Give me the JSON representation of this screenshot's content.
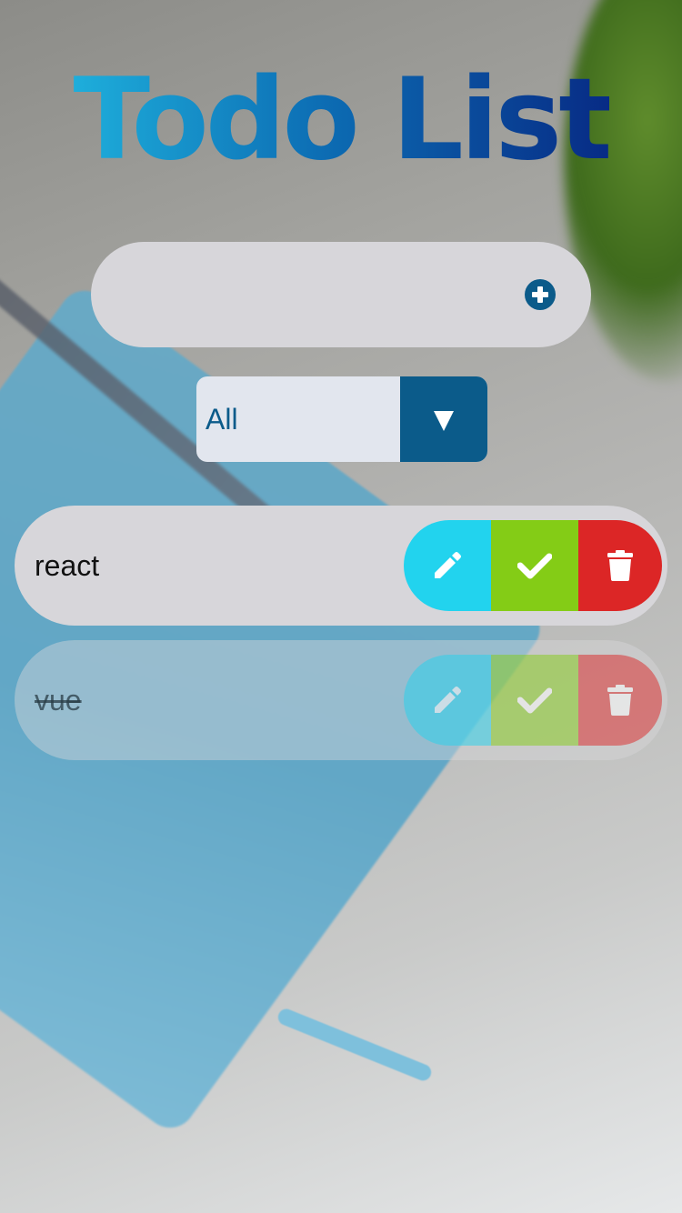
{
  "app": {
    "title": "Todo List"
  },
  "new_todo": {
    "value": "",
    "placeholder": "",
    "add_icon": "plus-circle-icon"
  },
  "filter": {
    "selected": "All",
    "toggle_icon": "triangle-down-icon"
  },
  "todos": [
    {
      "text": "react",
      "completed": false
    },
    {
      "text": "vue",
      "completed": true
    }
  ],
  "actions": {
    "edit_icon": "pencil-icon",
    "complete_icon": "check-icon",
    "delete_icon": "trash-icon"
  },
  "colors": {
    "primary": "#0b5b8a",
    "edit": "#22d3ee",
    "complete": "#84cc16",
    "delete": "#dc2626",
    "bar_background": "#d7d6da",
    "title_gradient_start": "#1eaedb",
    "title_gradient_end": "#072b85"
  }
}
